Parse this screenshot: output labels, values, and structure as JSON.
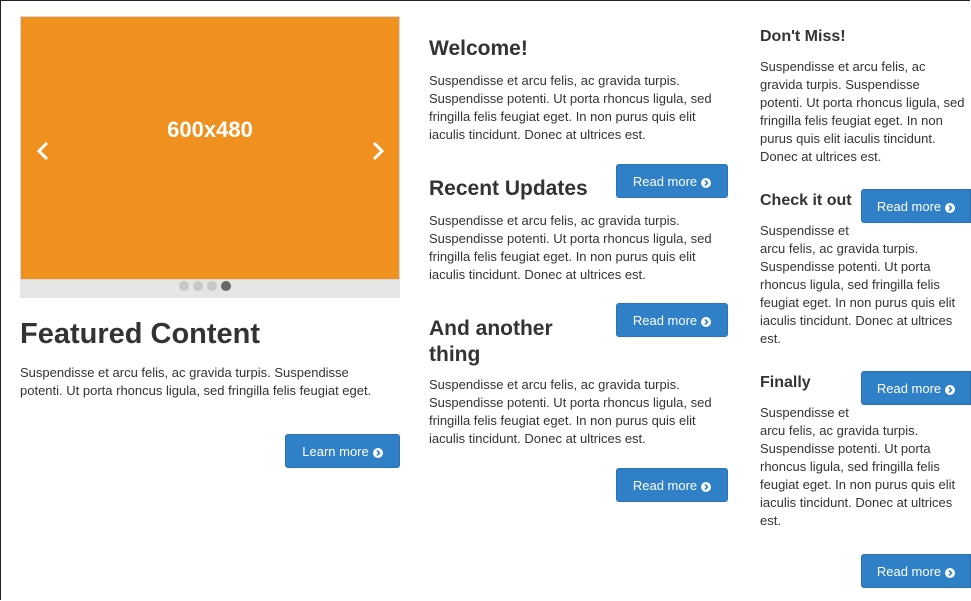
{
  "carousel": {
    "image_label": "600x480",
    "prev_icon": "chevron-left-icon",
    "next_icon": "chevron-right-icon",
    "dots": [
      false,
      false,
      false,
      true
    ],
    "color": "#f0901f"
  },
  "featured": {
    "title": "Featured Content",
    "text": "Suspendisse et arcu felis, ac gravida turpis. Suspendisse potenti. Ut porta rhoncus ligula, sed fringilla felis feugiat eget.",
    "button": "Learn more"
  },
  "middle": {
    "welcome": {
      "title": "Welcome!",
      "text": "Suspendisse et arcu felis, ac gravida turpis. Suspendisse potenti. Ut porta rhoncus ligula, sed fringilla felis feugiat eget. In non purus quis elit iaculis tincidunt. Donec at ultrices est."
    },
    "updates": {
      "title": "Recent Updates",
      "button": "Read more",
      "text": "Suspendisse et arcu felis, ac gravida turpis. Suspendisse potenti. Ut porta rhoncus ligula, sed fringilla felis feugiat eget. In non purus quis elit iaculis tincidunt. Donec at ultrices est."
    },
    "another": {
      "title_line1": "And another",
      "title_line2": "thing",
      "button": "Read more",
      "text": "Suspendisse et arcu felis, ac gravida turpis. Suspendisse potenti. Ut porta rhoncus ligula, sed fringilla felis feugiat eget. In non purus quis elit iaculis tincidunt. Donec at ultrices est.",
      "button_bottom": "Read more"
    }
  },
  "right": {
    "dontmiss": {
      "title": "Don't Miss!",
      "text": "Suspendisse et arcu felis, ac gravida turpis. Suspendisse potenti. Ut porta rhoncus ligula, sed fringilla felis feugiat eget. In non purus quis elit iaculis tincidunt. Donec at ultrices est."
    },
    "checkit": {
      "title": "Check it out",
      "button": "Read more",
      "text": "Suspendisse et arcu felis, ac gravida turpis. Suspendisse potenti. Ut porta rhoncus ligula, sed fringilla felis feugiat eget. In non purus quis elit iaculis tincidunt. Donec at ultrices est."
    },
    "finally": {
      "title": "Finally",
      "button": "Read more",
      "text": "Suspendisse et arcu felis, ac gravida turpis. Suspendisse potenti. Ut porta rhoncus ligula, sed fringilla felis feugiat eget. In non purus quis elit iaculis tincidunt. Donec at ultrices est.",
      "button_bottom": "Read more"
    }
  },
  "colors": {
    "button": "#2f80c6",
    "accent": "#f0901f"
  }
}
